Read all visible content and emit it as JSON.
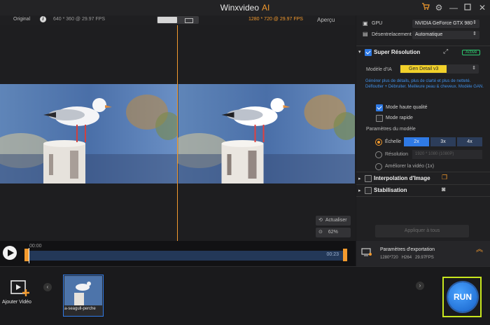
{
  "app": {
    "title": "Winxvideo",
    "title_ai": "AI"
  },
  "header": {
    "original_label": "Original",
    "original_info": "640 * 360 @ 29.97 FPS",
    "output_info": "1280 * 720 @ 29.97 FPS",
    "preview_label": "Aperçu"
  },
  "preview_controls": {
    "refresh_label": "Actualiser",
    "zoom_label": "62%"
  },
  "timeline": {
    "start_time": "00:00",
    "end_time": "00:23",
    "playhead_progress": 0.0
  },
  "gpu": {
    "label": "GPU",
    "value": "NVIDIA GeForce GTX 980"
  },
  "deinterlace": {
    "label": "Désentrelacement",
    "value": "Automatique"
  },
  "super_resolution": {
    "title": "Super Résolution",
    "status": "Activé",
    "model_label": "Modèle d'IA",
    "model_value": "Gen Detail v3",
    "description": "Générer plus de détails, plus de clarté et plus de netteté. Défloutter + Débruiter. Meilleure peau & cheveux. Modèle GAN.",
    "high_quality_label": "Mode haute qualité",
    "fast_label": "Mode rapide",
    "params_label": "Paramètres du modèle",
    "scale_label": "Échelle",
    "scales": [
      "2x",
      "3x",
      "4x"
    ],
    "resolution_label": "Résolution",
    "resolution_value": "1920 * 1080 (1080P)",
    "improve_label": "Améliorer la vidéo (1x)"
  },
  "interpolation": {
    "title": "Interpolation d'Image"
  },
  "stabilization": {
    "title": "Stabilisation"
  },
  "apply_all_label": "Appliquer à tous",
  "export": {
    "title": "Paramètres d'exportation",
    "info": "1280*720   H264   29.97FPS"
  },
  "bottom": {
    "add_video_label": "Ajouter Vidéo",
    "clip_name": "a-seagull-perche",
    "run_label": "RUN"
  },
  "colors": {
    "accent": "#f39a2e",
    "blue": "#2f7ae5",
    "active_green": "#2ecc71",
    "run_border": "#c8e61e"
  },
  "icons": [
    "cart-icon",
    "gear-icon",
    "minimize-icon",
    "maximize-icon",
    "close-icon",
    "info-icon",
    "play-icon",
    "refresh-icon",
    "zoom-icon",
    "expand-icon",
    "photo-icon",
    "camera-icon",
    "export-settings-icon",
    "chevron-up-icon",
    "add-video-icon",
    "chevron-left-icon",
    "chevron-right-icon"
  ]
}
